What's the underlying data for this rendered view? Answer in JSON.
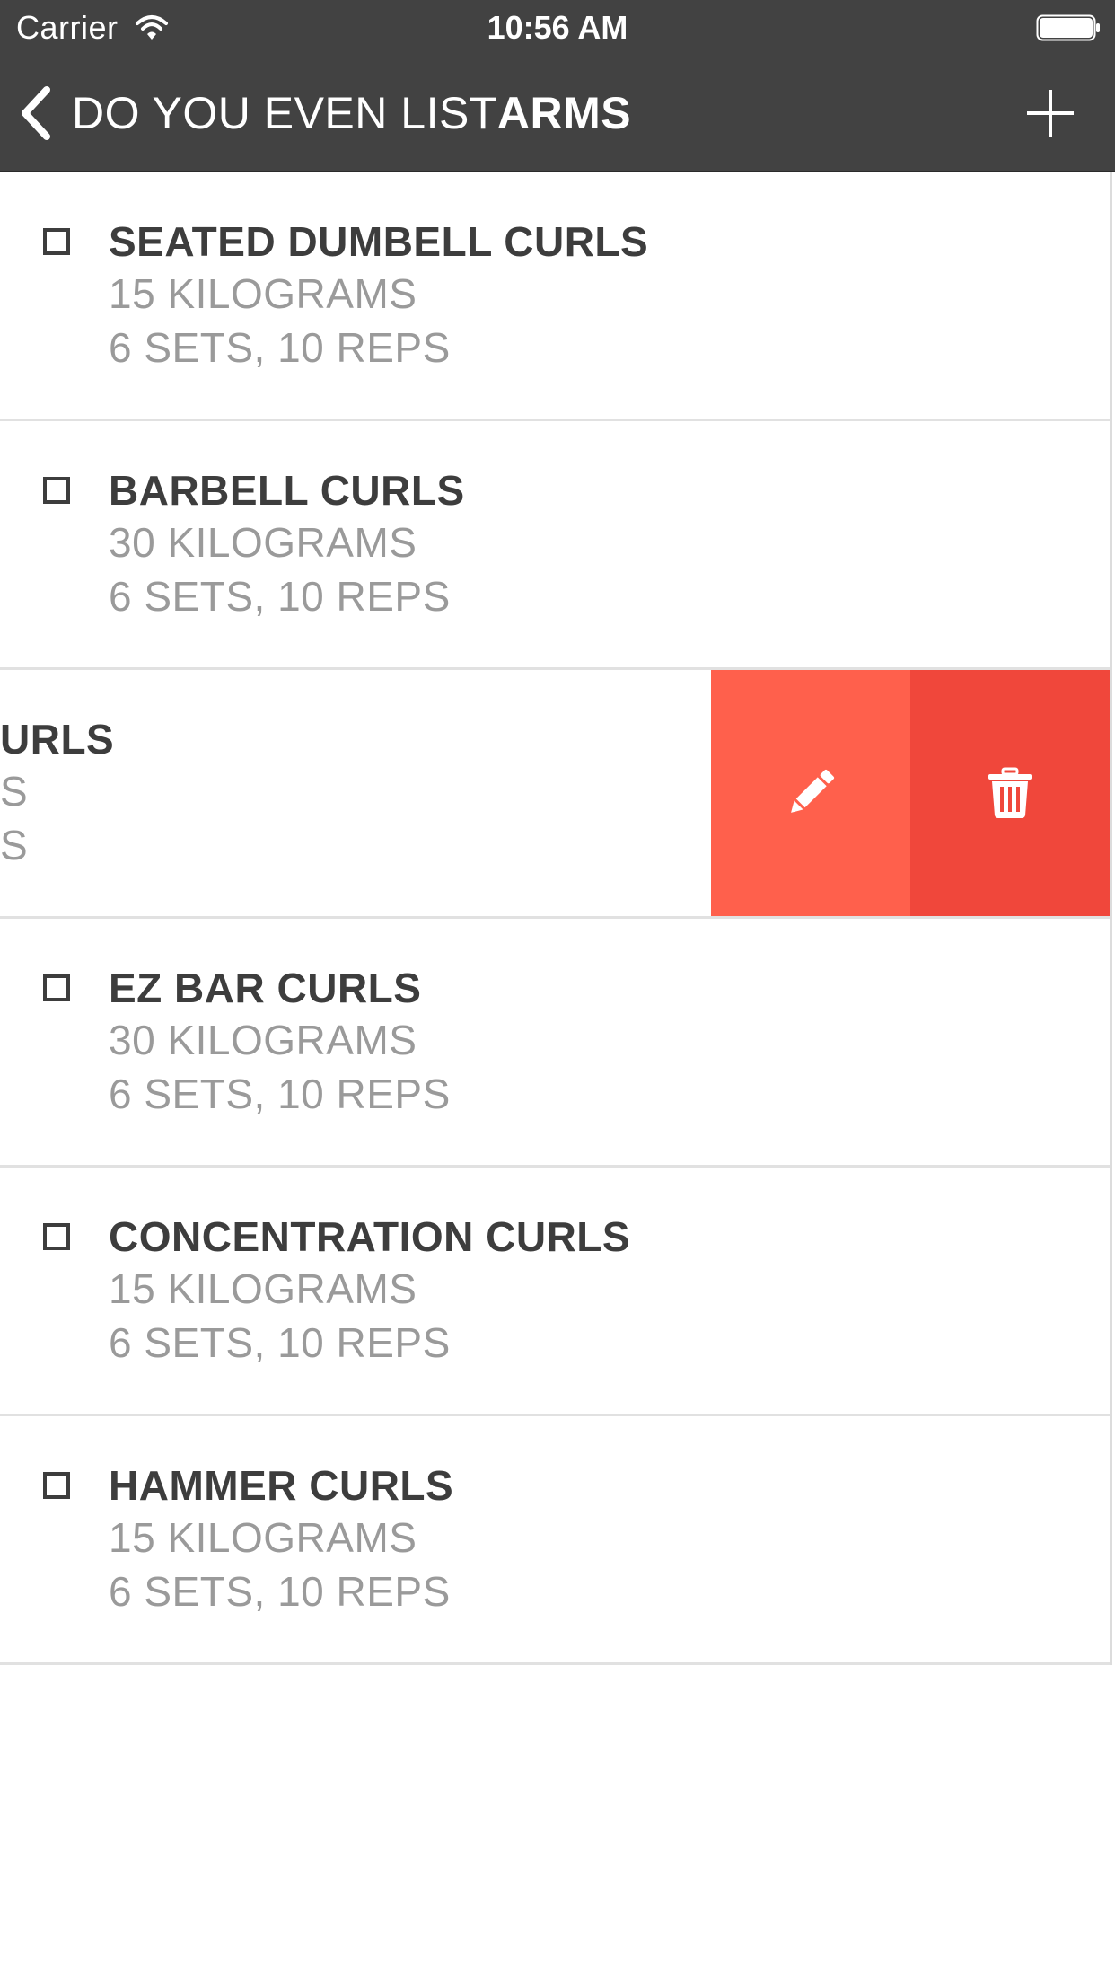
{
  "status_bar": {
    "carrier": "Carrier",
    "time": "10:56 AM"
  },
  "nav": {
    "title_prefix": "DO YOU EVEN LIST",
    "list_name": "ARMS"
  },
  "items": [
    {
      "title": "SEATED DUMBELL CURLS",
      "weight": "15 KILOGRAMS",
      "sets": "6 SETS, 10 REPS"
    },
    {
      "title": "BARBELL CURLS",
      "weight": "30 KILOGRAMS",
      "sets": "6 SETS, 10 REPS"
    },
    {
      "title": "URLS",
      "weight": "S",
      "sets": "S"
    },
    {
      "title": "EZ BAR CURLS",
      "weight": "30 KILOGRAMS",
      "sets": "6 SETS, 10 REPS"
    },
    {
      "title": "CONCENTRATION CURLS",
      "weight": "15 KILOGRAMS",
      "sets": "6 SETS, 10 REPS"
    },
    {
      "title": "HAMMER CURLS",
      "weight": "15 KILOGRAMS",
      "sets": "6 SETS, 10 REPS"
    }
  ],
  "icons": {
    "back": "chevron-left-icon",
    "add": "plus-icon",
    "edit": "pencil-icon",
    "delete": "trash-icon",
    "checkbox": "checkbox-unchecked-icon"
  },
  "colors": {
    "header": "#424242",
    "edit_action": "#ff604c",
    "delete_action": "#f0473b",
    "title_text": "#3d3d3d",
    "detail_text": "#9a9a9a"
  }
}
